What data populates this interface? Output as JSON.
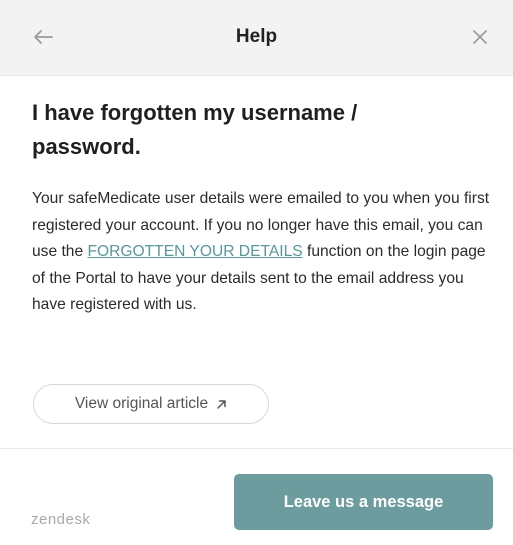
{
  "header": {
    "title": "Help"
  },
  "icons": {
    "back": "arrow-left-icon",
    "close": "close-icon",
    "external": "external-link-icon"
  },
  "article": {
    "title": "I have forgotten my username / password.",
    "body_before_link": "Your safeMedicate user details were emailed to you when you first registered your account. If you no longer have this email, you can use the ",
    "link_text": "FORGOTTEN YOUR DETAILS",
    "body_after_link": " function on the login page of the Portal to have your details sent to the email address you have registered with us.",
    "view_original_label": "View original article"
  },
  "footer": {
    "brand": "zendesk",
    "leave_message_label": "Leave us a message"
  },
  "colors": {
    "header_bg": "#f3f3f3",
    "link": "#58979a",
    "primary_button": "#6c9c9e"
  }
}
